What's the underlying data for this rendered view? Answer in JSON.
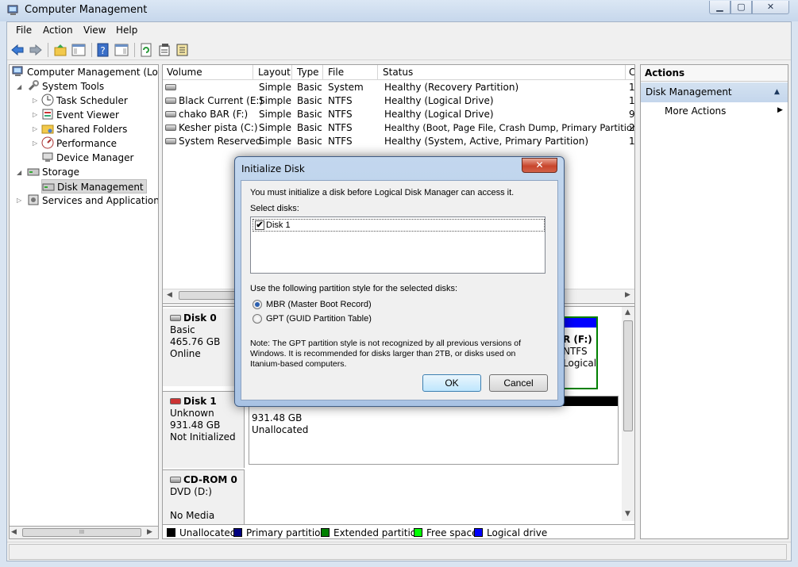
{
  "window": {
    "title": "Computer Management",
    "min": "▁",
    "max": "▢",
    "close": "✕"
  },
  "menu": [
    "File",
    "Action",
    "View",
    "Help"
  ],
  "tree": {
    "root": "Computer Management (Local",
    "system_tools": "System Tools",
    "task_scheduler": "Task Scheduler",
    "event_viewer": "Event Viewer",
    "shared_folders": "Shared Folders",
    "performance": "Performance",
    "device_manager": "Device Manager",
    "storage": "Storage",
    "disk_management": "Disk Management",
    "services": "Services and Applications",
    "scroll_mark": "III"
  },
  "volumes": {
    "headers": [
      "Volume",
      "Layout",
      "Type",
      "File System",
      "Status",
      "C"
    ],
    "rows": [
      {
        "volume": "",
        "layout": "Simple",
        "type": "Basic",
        "fs": "",
        "status": "Healthy (Recovery Partition)",
        "c": "1"
      },
      {
        "volume": "Black Current (E:)",
        "layout": "Simple",
        "type": "Basic",
        "fs": "NTFS",
        "status": "Healthy (Logical Drive)",
        "c": "1"
      },
      {
        "volume": "chako BAR (F:)",
        "layout": "Simple",
        "type": "Basic",
        "fs": "NTFS",
        "status": "Healthy (Logical Drive)",
        "c": "9"
      },
      {
        "volume": "Kesher pista (C:)",
        "layout": "Simple",
        "type": "Basic",
        "fs": "NTFS",
        "status": "Healthy (Boot, Page File, Crash Dump, Primary Partition)",
        "c": "2"
      },
      {
        "volume": "System Reserved",
        "layout": "Simple",
        "type": "Basic",
        "fs": "NTFS",
        "status": "Healthy (System, Active, Primary Partition)",
        "c": "1"
      }
    ]
  },
  "disks": {
    "disk0": {
      "name": "Disk 0",
      "type": "Basic",
      "size": "465.76 GB",
      "state": "Online",
      "part_name": "R  (F:)",
      "part_fs": "NTFS",
      "part_status": "Logical"
    },
    "disk1": {
      "name": "Disk 1",
      "type": "Unknown",
      "size": "931.48 GB",
      "state": "Not Initialized",
      "part_size": "931.48 GB",
      "part_status": "Unallocated"
    },
    "cdrom": {
      "name": "CD-ROM 0",
      "type": "DVD (D:)",
      "state": "No Media"
    }
  },
  "legend": [
    {
      "label": "Unallocated",
      "color": "#000000"
    },
    {
      "label": "Primary partition",
      "color": "#000080"
    },
    {
      "label": "Extended partition",
      "color": "#008000"
    },
    {
      "label": "Free space",
      "color": "#00ff00"
    },
    {
      "label": "Logical drive",
      "color": "#0000ff"
    }
  ],
  "actions": {
    "header": "Actions",
    "section": "Disk Management",
    "more": "More Actions"
  },
  "dialog": {
    "title": "Initialize Disk",
    "close": "✕",
    "intro": "You must initialize a disk before Logical Disk Manager can access it.",
    "select_label": "Select disks:",
    "disk_item": "Disk 1",
    "disk_checked": "✔",
    "style_label": "Use the following partition style for the selected disks:",
    "mbr": "MBR (Master Boot Record)",
    "gpt": "GPT (GUID Partition Table)",
    "note_1": "Note: The GPT partition style is not recognized by all previous versions of",
    "note_2": "Windows. It is recommended for disks larger than 2TB, or disks used on",
    "note_3": "Itanium-based computers.",
    "ok": "OK",
    "cancel": "Cancel"
  }
}
